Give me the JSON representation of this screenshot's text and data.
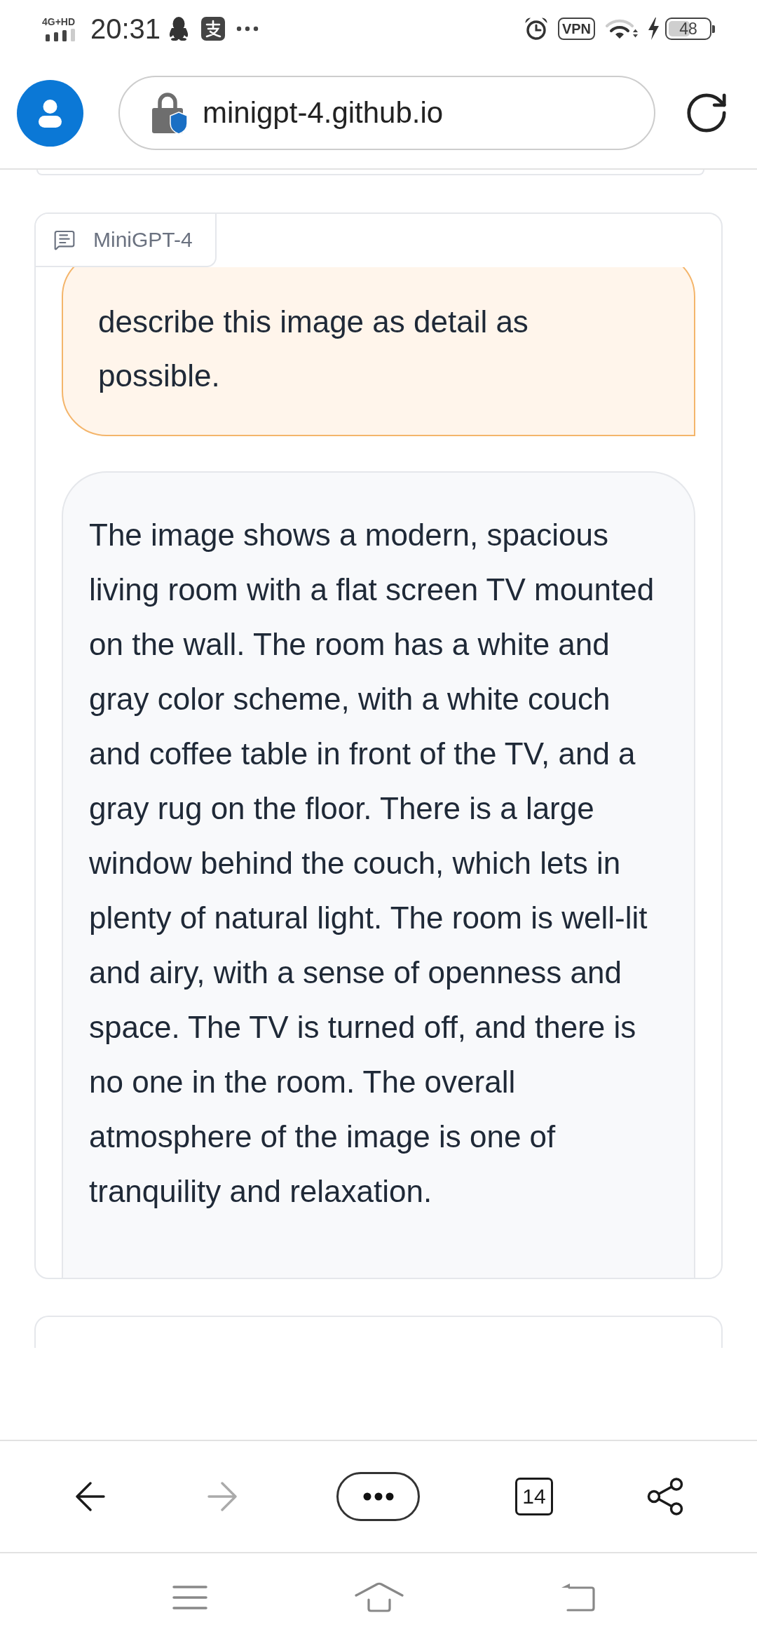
{
  "status_bar": {
    "network": "4G+HD",
    "time": "20:31",
    "vpn": "VPN",
    "battery": "48"
  },
  "browser_bar": {
    "url": "minigpt-4.github.io"
  },
  "chat": {
    "title": "MiniGPT-4",
    "messages": [
      {
        "kind": "user",
        "text": "describe this image as detail as possible."
      },
      {
        "kind": "bot",
        "text": "The image shows a modern, spacious living room with a flat screen TV mounted on the wall. The room has a white and gray color scheme, with a white couch and coffee table in front of the TV, and a gray rug on the floor. There is a large window behind the couch, which lets in plenty of natural light. The room is well-lit and airy, with a sense of openness and space. The TV is turned off, and there is no one in the room. The overall atmosphere of the image is one of tranquility and relaxation."
      }
    ]
  },
  "toolbar": {
    "back_disabled": false,
    "forward_disabled": true,
    "tab_count": "14"
  }
}
